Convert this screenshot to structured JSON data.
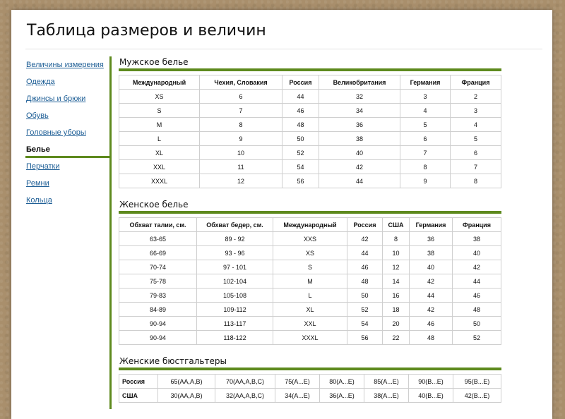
{
  "page": {
    "title": "Таблица размеров и величин"
  },
  "sidebar": {
    "items": [
      {
        "label": "Величины измерения",
        "active": false
      },
      {
        "label": "Одежда",
        "active": false
      },
      {
        "label": "Джинсы и брюки",
        "active": false
      },
      {
        "label": "Обувь",
        "active": false
      },
      {
        "label": "Головные уборы",
        "active": false
      },
      {
        "label": "Белье",
        "active": true
      },
      {
        "label": "Перчатки",
        "active": false
      },
      {
        "label": "Ремни",
        "active": false
      },
      {
        "label": "Кольца",
        "active": false
      }
    ]
  },
  "sections": {
    "men": {
      "title": "Мужское белье",
      "headers": [
        "Международный",
        "Чехия, Словакия",
        "Россия",
        "Великобритания",
        "Германия",
        "Франция"
      ],
      "rows": [
        [
          "XS",
          "6",
          "44",
          "32",
          "3",
          "2"
        ],
        [
          "S",
          "7",
          "46",
          "34",
          "4",
          "3"
        ],
        [
          "M",
          "8",
          "48",
          "36",
          "5",
          "4"
        ],
        [
          "L",
          "9",
          "50",
          "38",
          "6",
          "5"
        ],
        [
          "XL",
          "10",
          "52",
          "40",
          "7",
          "6"
        ],
        [
          "XXL",
          "11",
          "54",
          "42",
          "8",
          "7"
        ],
        [
          "XXXL",
          "12",
          "56",
          "44",
          "9",
          "8"
        ]
      ]
    },
    "women": {
      "title": "Женское белье",
      "headers": [
        "Обхват талии, см.",
        "Обхват бедер, см.",
        "Международный",
        "Россия",
        "США",
        "Германия",
        "Франция"
      ],
      "rows": [
        [
          "63-65",
          "89 - 92",
          "XXS",
          "42",
          "8",
          "36",
          "38"
        ],
        [
          "66-69",
          "93 - 96",
          "XS",
          "44",
          "10",
          "38",
          "40"
        ],
        [
          "70-74",
          "97 - 101",
          "S",
          "46",
          "12",
          "40",
          "42"
        ],
        [
          "75-78",
          "102-104",
          "M",
          "48",
          "14",
          "42",
          "44"
        ],
        [
          "79-83",
          "105-108",
          "L",
          "50",
          "16",
          "44",
          "46"
        ],
        [
          "84-89",
          "109-112",
          "XL",
          "52",
          "18",
          "42",
          "48"
        ],
        [
          "90-94",
          "113-117",
          "XXL",
          "54",
          "20",
          "46",
          "50"
        ],
        [
          "90-94",
          "118-122",
          "XXXL",
          "56",
          "22",
          "48",
          "52"
        ]
      ]
    },
    "bras": {
      "title": "Женские бюстгальтеры",
      "rows": [
        [
          "Россия",
          "65(AA,A,B)",
          "70(AA,A,B,C)",
          "75(A...E)",
          "80(A...E)",
          "85(A...E)",
          "90(B...E)",
          "95(B...E)"
        ],
        [
          "США",
          "30(AA,A,B)",
          "32(AA,A,B,C)",
          "34(A...E)",
          "36(A...E)",
          "38(A...E)",
          "40(B...E)",
          "42(B...E)"
        ]
      ]
    }
  },
  "colors": {
    "accent": "#5e8a1e",
    "link": "#1f5f96"
  }
}
